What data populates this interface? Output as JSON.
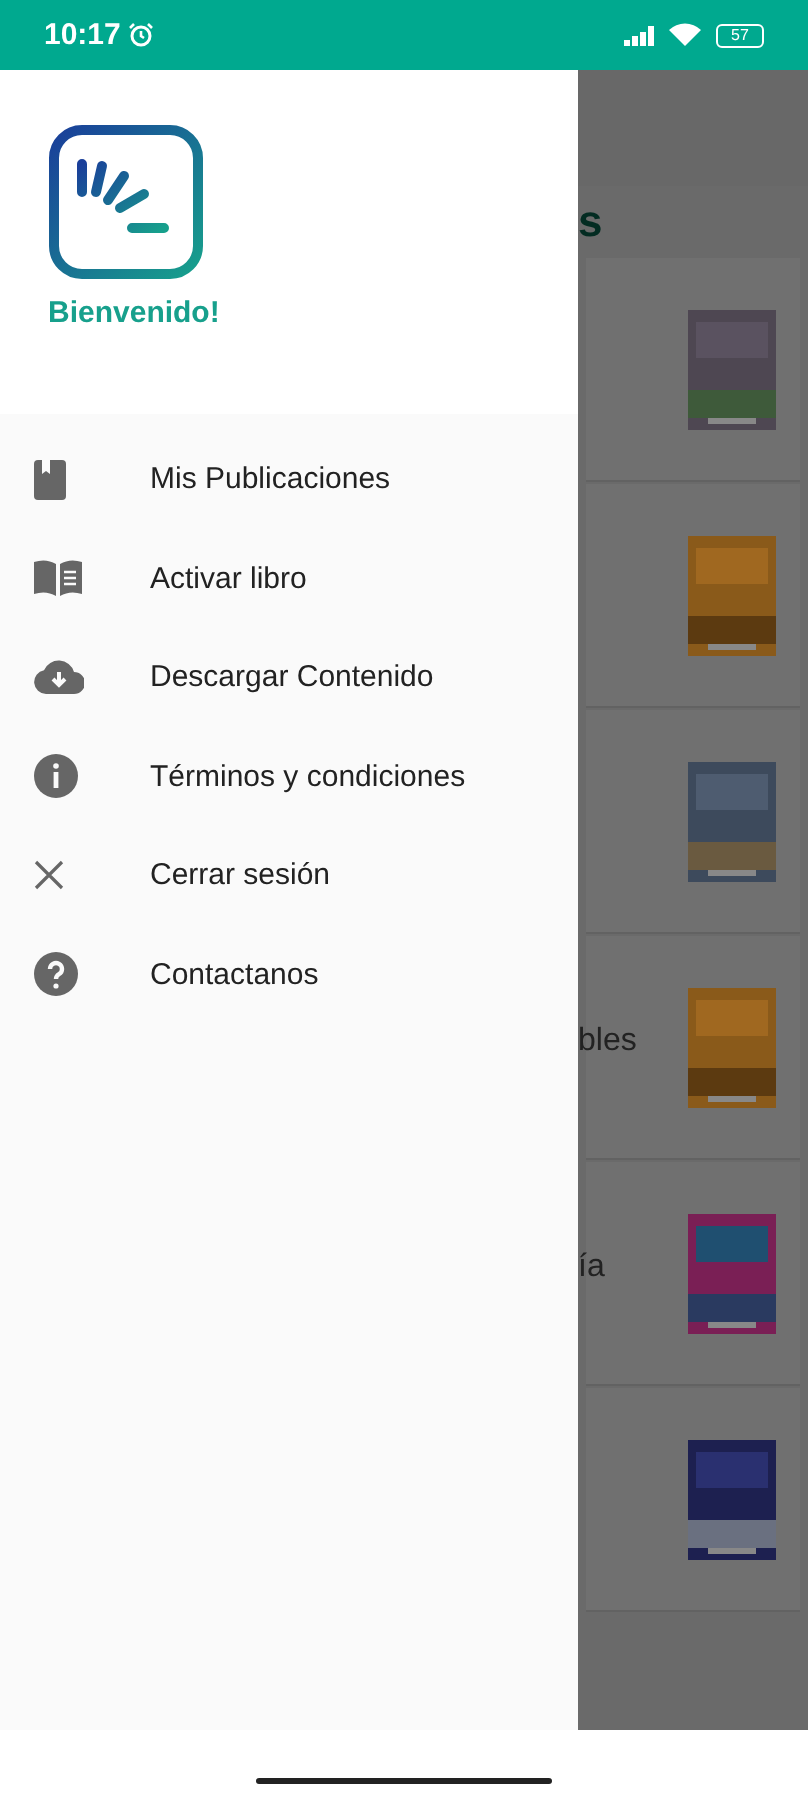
{
  "status_bar": {
    "time": "10:17",
    "battery": "57"
  },
  "drawer": {
    "greeting": "Bienvenido!",
    "items": [
      {
        "kind": "book",
        "label": "Mis Publicaciones"
      },
      {
        "kind": "open-book",
        "label": "Activar libro"
      },
      {
        "kind": "download",
        "label": "Descargar Contenido"
      },
      {
        "kind": "info",
        "label": "Términos y condiciones"
      },
      {
        "kind": "close",
        "label": "Cerrar sesión"
      },
      {
        "kind": "help",
        "label": "Contactanos"
      }
    ]
  },
  "background": {
    "title_fragment": "s",
    "cards": [
      {
        "cover": {
          "kind": "picture"
        }
      },
      {
        "cover": {
          "kind": "picture"
        }
      },
      {
        "cover": {
          "kind": "picture"
        }
      },
      {
        "text_fragment": "bles",
        "cover": {
          "kind": "picture"
        }
      },
      {
        "text_fragment": "ía",
        "cover": {
          "kind": "picture"
        }
      },
      {
        "cover": {
          "kind": "picture"
        }
      }
    ]
  }
}
